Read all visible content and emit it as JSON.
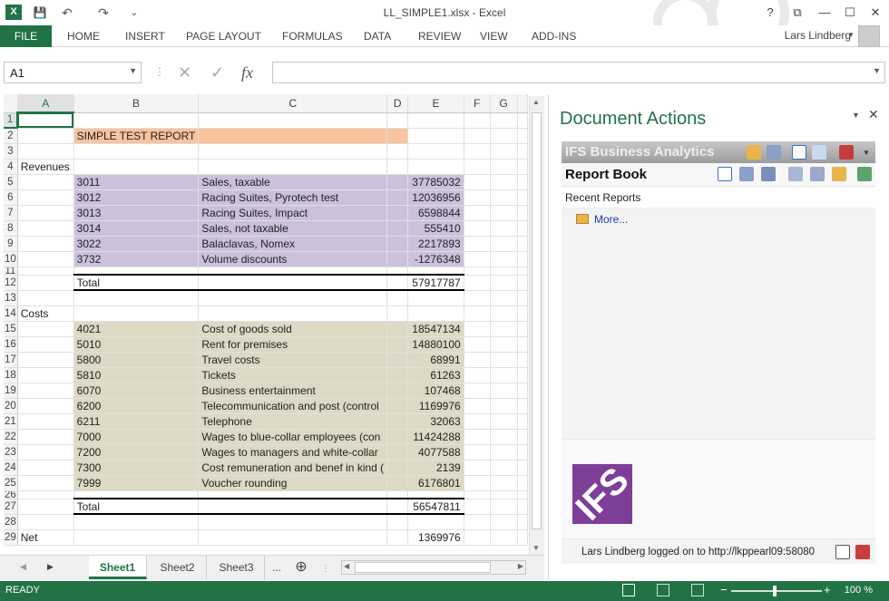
{
  "window": {
    "title": "LL_SIMPLE1.xlsx - Excel",
    "buttons": {
      "help": "?",
      "restore": "⧉",
      "minimize": "—",
      "maximize": "☐",
      "close": "✕"
    }
  },
  "quick_access": {
    "save": "💾",
    "undo": "↶",
    "redo": "↷",
    "more": "⌄"
  },
  "ribbon": {
    "file": "FILE",
    "tabs": [
      "HOME",
      "INSERT",
      "PAGE LAYOUT",
      "FORMULAS",
      "DATA",
      "REVIEW",
      "VIEW",
      "ADD-INS"
    ],
    "user": "Lars Lindberg"
  },
  "formula_bar": {
    "name_box": "A1",
    "fx": "fx",
    "cancel": "✕",
    "enter": "✓",
    "value": ""
  },
  "grid": {
    "columns": [
      "A",
      "B",
      "C",
      "D",
      "E",
      "F",
      "G"
    ],
    "rows": [
      {
        "n": "1",
        "a": "",
        "b": "",
        "c": "",
        "e": ""
      },
      {
        "n": "2",
        "a": "",
        "b": "SIMPLE TEST REPORT",
        "c": "",
        "e": ""
      },
      {
        "n": "3",
        "a": "",
        "b": "",
        "c": "",
        "e": ""
      },
      {
        "n": "4",
        "a": "Revenues",
        "b": "",
        "c": "",
        "e": ""
      },
      {
        "n": "5",
        "a": "",
        "b": "3011",
        "c": "Sales, taxable",
        "e": "37785032"
      },
      {
        "n": "6",
        "a": "",
        "b": "3012",
        "c": "Racing Suites, Pyrotech test",
        "e": "12036956"
      },
      {
        "n": "7",
        "a": "",
        "b": "3013",
        "c": "Racing Suites, Impact",
        "e": "6598844"
      },
      {
        "n": "8",
        "a": "",
        "b": "3014",
        "c": "Sales, not taxable",
        "e": "555410"
      },
      {
        "n": "9",
        "a": "",
        "b": "3022",
        "c": "Balaclavas, Nomex",
        "e": "2217893"
      },
      {
        "n": "10",
        "a": "",
        "b": "3732",
        "c": "Volume discounts",
        "e": "-1276348"
      },
      {
        "n": "11",
        "a": "",
        "b": "",
        "c": "",
        "e": ""
      },
      {
        "n": "12",
        "a": "",
        "b": "Total",
        "c": "",
        "e": "57917787"
      },
      {
        "n": "13",
        "a": "",
        "b": "",
        "c": "",
        "e": ""
      },
      {
        "n": "14",
        "a": "Costs",
        "b": "",
        "c": "",
        "e": ""
      },
      {
        "n": "15",
        "a": "",
        "b": "4021",
        "c": "Cost of goods sold",
        "e": "18547134"
      },
      {
        "n": "16",
        "a": "",
        "b": "5010",
        "c": "Rent for premises",
        "e": "14880100"
      },
      {
        "n": "17",
        "a": "",
        "b": "5800",
        "c": "Travel costs",
        "e": "68991"
      },
      {
        "n": "18",
        "a": "",
        "b": "5810",
        "c": "Tickets",
        "e": "61263"
      },
      {
        "n": "19",
        "a": "",
        "b": "6070",
        "c": "Business entertainment",
        "e": "107468"
      },
      {
        "n": "20",
        "a": "",
        "b": "6200",
        "c": "Telecommunication and post (control",
        "e": "1169976"
      },
      {
        "n": "21",
        "a": "",
        "b": "6211",
        "c": "Telephone",
        "e": "32063"
      },
      {
        "n": "22",
        "a": "",
        "b": "7000",
        "c": "Wages to blue-collar employees (con",
        "e": "11424288"
      },
      {
        "n": "23",
        "a": "",
        "b": "7200",
        "c": "Wages to managers and white-collar",
        "e": "4077588"
      },
      {
        "n": "24",
        "a": "",
        "b": "7300",
        "c": "Cost remuneration and benef in kind (",
        "e": "2139"
      },
      {
        "n": "25",
        "a": "",
        "b": "7999",
        "c": "Voucher rounding",
        "e": "6176801"
      },
      {
        "n": "26",
        "a": "",
        "b": "",
        "c": "",
        "e": ""
      },
      {
        "n": "27",
        "a": "",
        "b": "Total",
        "c": "",
        "e": "56547811"
      },
      {
        "n": "28",
        "a": "",
        "b": "",
        "c": "",
        "e": ""
      },
      {
        "n": "29",
        "a": "Net",
        "b": "",
        "c": "",
        "e": "1369976"
      }
    ]
  },
  "sheets": {
    "tabs": [
      "Sheet1",
      "Sheet2",
      "Sheet3"
    ],
    "more": "...",
    "add": "⊕",
    "prev": "◀",
    "next": "▶"
  },
  "task_pane": {
    "title": "Document Actions",
    "ifs_title": "IFS Business Analytics",
    "report_book": "Report Book",
    "recent_reports": "Recent Reports",
    "more_link": "More...",
    "logo_text": "IFS",
    "status": "Lars Lindberg logged on to http://lkppearl09:58080"
  },
  "status_bar": {
    "ready": "READY",
    "zoom": "100 %",
    "zoom_minus": "−",
    "zoom_plus": "+"
  },
  "colors": {
    "accent": "#217346",
    "orange": "#f8c39e",
    "purple": "#ccc0da",
    "tan": "#ddd9c4",
    "ifs": "#7e3f98"
  }
}
